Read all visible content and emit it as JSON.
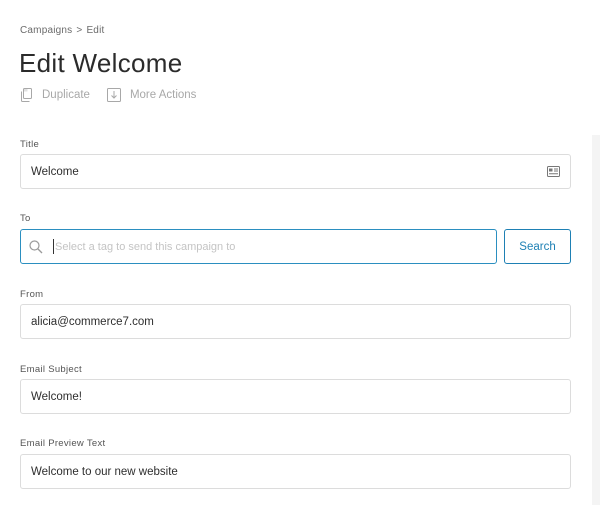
{
  "breadcrumb": {
    "parent": "Campaigns",
    "separator": ">",
    "current": "Edit"
  },
  "page_title": "Edit Welcome",
  "actions": [
    {
      "label": "Duplicate",
      "icon": "duplicate-icon"
    },
    {
      "label": "More Actions",
      "icon": "download-arrow-icon"
    }
  ],
  "form": {
    "title": {
      "label": "Title",
      "value": "Welcome",
      "icon": "id-card-icon"
    },
    "to": {
      "label": "To",
      "placeholder": "Select a tag to send this campaign to",
      "button_label": "Search",
      "icon": "search-icon"
    },
    "from": {
      "label": "From",
      "value": "alicia@commerce7.com"
    },
    "subject": {
      "label": "Email Subject",
      "value": "Welcome!"
    },
    "preview": {
      "label": "Email Preview Text",
      "value": "Welcome to our new website"
    }
  },
  "colors": {
    "accent": "#1e80b4",
    "border": "#dcdcdc",
    "muted_text": "#a8a8a8"
  }
}
